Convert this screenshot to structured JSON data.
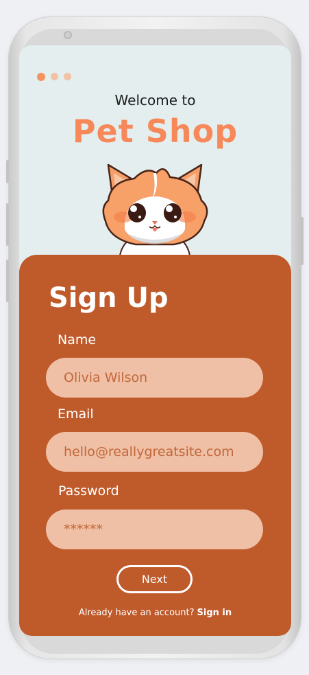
{
  "onboarding": {
    "total_steps": 3,
    "current_step": 1
  },
  "header": {
    "welcome": "Welcome to",
    "brand": "Pet Shop",
    "mascot_icon": "cat-mascot-icon"
  },
  "signup": {
    "title": "Sign Up",
    "name_label": "Name",
    "name_value": "Olivia Wilson",
    "email_label": "Email",
    "email_value": "hello@reallygreatsite.com",
    "password_label": "Password",
    "password_value": "******",
    "next_label": "Next",
    "footer_text": "Already have an account?",
    "signin_label": "Sign in"
  },
  "colors": {
    "accent": "#f6885a",
    "card": "#bf5a2b",
    "field": "#efc0a5",
    "screen_bg": "#e4eeef"
  }
}
